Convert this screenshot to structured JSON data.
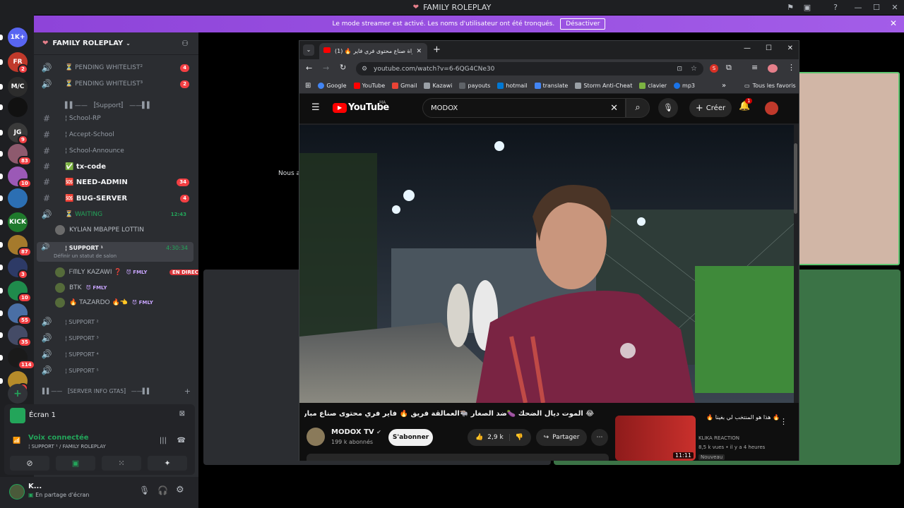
{
  "window": {
    "title": "FAMILY ROLEPLAY"
  },
  "banner": {
    "text": "Le mode streamer est activé. Les noms d'utilisateur ont été tronqués.",
    "button": "Désactiver"
  },
  "servers": [
    {
      "label": "1K+",
      "color": "#5865f2",
      "badge": ""
    },
    {
      "label": "FR",
      "color": "#c0392b",
      "badge": "2"
    },
    {
      "label": "M/C",
      "color": "#2c2c2c",
      "badge": ""
    },
    {
      "label": "",
      "color": "#111111",
      "badge": ""
    },
    {
      "label": "JG",
      "color": "#3a3a3a",
      "badge": "9"
    },
    {
      "label": "",
      "color": "#8e5a6e",
      "badge": "83"
    },
    {
      "label": "",
      "color": "#9b59b6",
      "badge": "10"
    },
    {
      "label": "",
      "color": "#2c6fb3",
      "badge": ""
    },
    {
      "label": "KICK",
      "color": "#1f7a2c",
      "badge": ""
    },
    {
      "label": "",
      "color": "#a57a2c",
      "badge": "87"
    },
    {
      "label": "",
      "color": "#2d3a66",
      "badge": "3"
    },
    {
      "label": "",
      "color": "#1f8b4c",
      "badge": "10"
    },
    {
      "label": "",
      "color": "#4a6fa5",
      "badge": "55"
    },
    {
      "label": "",
      "color": "#444b66",
      "badge": "35"
    },
    {
      "label": "",
      "color": "#1a1a1a",
      "badge": "114"
    },
    {
      "label": "",
      "color": "#b58b2a",
      "badge": "1"
    }
  ],
  "sidebar": {
    "server_name": "FAMILY ROLEPLAY",
    "channels": [
      {
        "icon": "🔊",
        "label": "⏳ PENDING WHITELIST²",
        "badge": "4",
        "bold": false
      },
      {
        "icon": "🔊",
        "label": "⏳ PENDING WHITELIST³",
        "badge": "2",
        "bold": false
      },
      {
        "icon": "",
        "label": "▌▌—— 〚Support〛 ——▌▌",
        "badge": "",
        "bold": false
      },
      {
        "icon": "#",
        "label": "¦ School-RP",
        "badge": "",
        "bold": false
      },
      {
        "icon": "#",
        "label": "¦ Accept-School",
        "badge": "",
        "bold": false
      },
      {
        "icon": "#",
        "label": "¦ School-Announce",
        "badge": "",
        "bold": false
      },
      {
        "icon": "#",
        "label": "✅ tx-code",
        "badge": "",
        "bold": true
      },
      {
        "icon": "#",
        "label": "🆘 NEED-ADMIN",
        "badge": "34",
        "bold": true
      },
      {
        "icon": "#",
        "label": "🆘 BUG-SERVER",
        "badge": "4",
        "bold": true
      },
      {
        "icon": "🔊",
        "label": "⏳ WAITING",
        "badge": "12:43",
        "bold": false
      }
    ],
    "waiting_user": "KYLIAN MBAPPE LOTTIN",
    "support1": {
      "label": "¦ SUPPORT ¹",
      "time": "4:30:34",
      "status": "Définir un statut de salon"
    },
    "support_users": [
      {
        "name": "ᖴᗰᒪY KAZAWI ❓",
        "tag": "😈 FMLY",
        "live": "EN DIRECT"
      },
      {
        "name": "BTK",
        "tag": "😈 FMLY",
        "live": ""
      },
      {
        "name": "🔥 TAZARDO 🔥👈",
        "tag": "😈 FMLY",
        "live": ""
      }
    ],
    "support_more": [
      "¦ SUPPORT ²",
      "¦ SUPPORT ³",
      "¦ SUPPORT ⁴",
      "¦ SUPPORT ⁵"
    ],
    "category2": "▌▌—— 〚SERVER INFO GTA5〛 ——▌▌"
  },
  "voice": {
    "screen_label": "Écran 1",
    "connected": "Voix connectée",
    "channel": "¦ SUPPORT ¹ / FAMILY ROLEPLAY"
  },
  "user": {
    "name": "K...",
    "status": "En partage d'écran"
  },
  "main": {
    "stage_text": "Nous av"
  },
  "chrome": {
    "tab_title": "(1) 🔥 مباراة صناع محتوى فري فاير",
    "url": "youtube.com/watch?v=6-6QG4CNe30",
    "bookmarks": [
      "Google",
      "YouTube",
      "Gmail",
      "Kazawi",
      "payouts",
      "hotmail",
      "translate",
      "Storm Anti-Cheat",
      "clavier",
      "mp3"
    ],
    "all_bookmarks": "Tous les favoris",
    "colors": {
      "accent": "#ff0000"
    }
  },
  "youtube": {
    "logo": "YouTube",
    "region": "MA",
    "search": "MODOX",
    "create": "Créer",
    "notif_count": "1",
    "video_title": "😂 الموت ديال الضحك 🍆ضد الصغار 🐃العمالقة فريق 🔥 فاير فري محتوى صناع مباراة",
    "channel": "MODOX TV",
    "subs": "199 k abonnés",
    "subscribe": "S'abonner",
    "likes": "2,9 k",
    "share": "Partager",
    "rec": {
      "title": "🔥 هذا هو المنتخب لي بغينا 🔥",
      "channel": "KLIKA REACTION",
      "meta": "8,5 k vues • il y a 4 heures",
      "badge": "Nouveau",
      "duration": "11:11"
    }
  }
}
